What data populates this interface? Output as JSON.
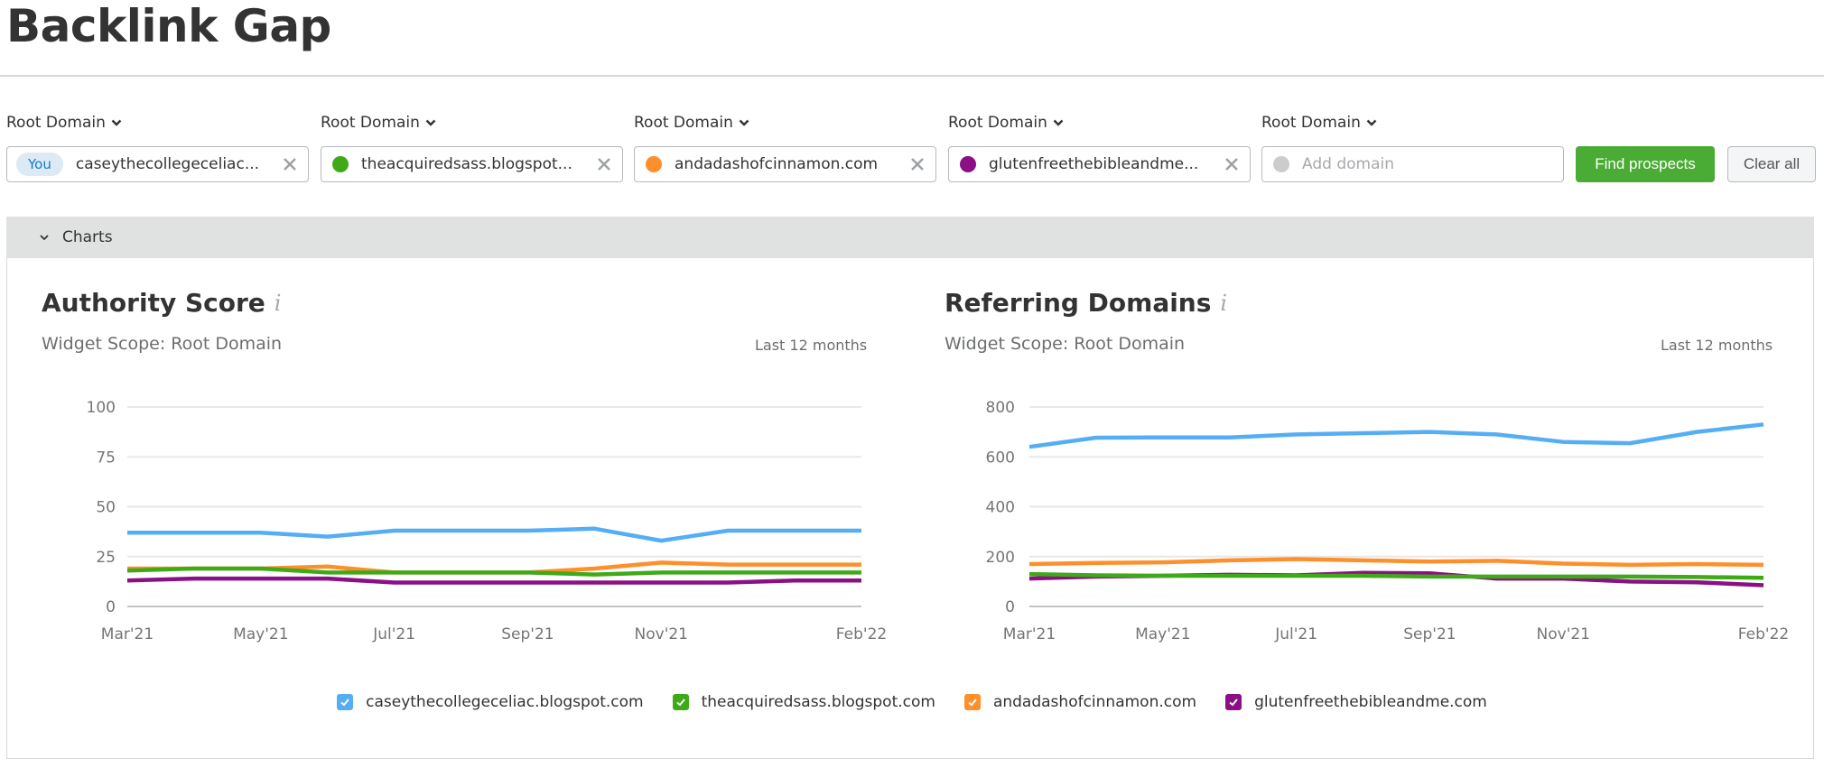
{
  "page": {
    "title": "Backlink Gap"
  },
  "domains": [
    {
      "scope": "Root Domain",
      "value": "caseythecollegeceliac...",
      "badge": "You",
      "color": "#55aef5",
      "placeholder": ""
    },
    {
      "scope": "Root Domain",
      "value": "theacquiredsass.blogspot...",
      "badge": "",
      "color": "#3eaa18",
      "placeholder": ""
    },
    {
      "scope": "Root Domain",
      "value": "andadashofcinnamon.com",
      "badge": "",
      "color": "#ff8f2b",
      "placeholder": ""
    },
    {
      "scope": "Root Domain",
      "value": "glutenfreethebibleandme...",
      "badge": "",
      "color": "#8b0f85",
      "placeholder": ""
    },
    {
      "scope": "Root Domain",
      "value": "",
      "badge": "",
      "color": "#cccccc",
      "placeholder": "Add domain"
    }
  ],
  "buttons": {
    "find": "Find prospects",
    "clear": "Clear all"
  },
  "charts_section": {
    "label": "Charts"
  },
  "widgets": [
    {
      "title": "Authority Score",
      "info": "i",
      "scope": "Widget Scope: Root Domain",
      "period": "Last 12 months"
    },
    {
      "title": "Referring Domains",
      "info": "i",
      "scope": "Widget Scope: Root Domain",
      "period": "Last 12 months"
    }
  ],
  "legend": [
    {
      "label": "caseythecollegeceliac.blogspot.com",
      "color": "#55aef5",
      "checked": true
    },
    {
      "label": "theacquiredsass.blogspot.com",
      "color": "#3eaa18",
      "checked": true
    },
    {
      "label": "andadashofcinnamon.com",
      "color": "#ff8f2b",
      "checked": true
    },
    {
      "label": "glutenfreethebibleandme.com",
      "color": "#8b0f85",
      "checked": true
    }
  ],
  "chart_data": [
    {
      "type": "line",
      "title": "Authority Score",
      "xlabel": "",
      "ylabel": "",
      "x": [
        "Mar'21",
        "Apr'21",
        "May'21",
        "Jun'21",
        "Jul'21",
        "Aug'21",
        "Sep'21",
        "Oct'21",
        "Nov'21",
        "Dec'21",
        "Jan'22",
        "Feb'22"
      ],
      "xtick_labels": {
        "0": "Mar'21",
        "2": "May'21",
        "4": "Jul'21",
        "6": "Sep'21",
        "8": "Nov'21",
        "11": "Feb'22"
      },
      "yticks": [
        0,
        25,
        50,
        75,
        100
      ],
      "ylim": [
        0,
        100
      ],
      "grid": true,
      "legend": "bottom",
      "series": [
        {
          "name": "caseythecollegeceliac.blogspot.com",
          "color": "#55aef5",
          "values": [
            37,
            37,
            37,
            35,
            38,
            38,
            38,
            39,
            33,
            38,
            38,
            38
          ]
        },
        {
          "name": "theacquiredsass.blogspot.com",
          "color": "#3eaa18",
          "values": [
            18,
            19,
            19,
            17,
            17,
            17,
            17,
            16,
            17,
            17,
            17,
            17
          ]
        },
        {
          "name": "andadashofcinnamon.com",
          "color": "#ff8f2b",
          "values": [
            19,
            19,
            19,
            20,
            17,
            17,
            17,
            19,
            22,
            21,
            21,
            21
          ]
        },
        {
          "name": "glutenfreethebibleandme.com",
          "color": "#8b0f85",
          "values": [
            13,
            14,
            14,
            14,
            12,
            12,
            12,
            12,
            12,
            12,
            13,
            13
          ]
        }
      ]
    },
    {
      "type": "line",
      "title": "Referring Domains",
      "xlabel": "",
      "ylabel": "",
      "x": [
        "Mar'21",
        "Apr'21",
        "May'21",
        "Jun'21",
        "Jul'21",
        "Aug'21",
        "Sep'21",
        "Oct'21",
        "Nov'21",
        "Dec'21",
        "Jan'22",
        "Feb'22"
      ],
      "xtick_labels": {
        "0": "Mar'21",
        "2": "May'21",
        "4": "Jul'21",
        "6": "Sep'21",
        "8": "Nov'21",
        "11": "Feb'22"
      },
      "yticks": [
        0,
        200,
        400,
        600,
        800
      ],
      "ylim": [
        0,
        800
      ],
      "grid": true,
      "legend": "bottom",
      "series": [
        {
          "name": "caseythecollegeceliac.blogspot.com",
          "color": "#55aef5",
          "values": [
            640,
            677,
            678,
            678,
            690,
            695,
            700,
            690,
            660,
            655,
            700,
            730
          ]
        },
        {
          "name": "theacquiredsass.blogspot.com",
          "color": "#3eaa18",
          "values": [
            130,
            125,
            123,
            123,
            123,
            123,
            120,
            120,
            120,
            120,
            118,
            115
          ]
        },
        {
          "name": "andadashofcinnamon.com",
          "color": "#ff8f2b",
          "values": [
            170,
            175,
            177,
            185,
            190,
            185,
            180,
            183,
            172,
            167,
            170,
            167
          ]
        },
        {
          "name": "glutenfreethebibleandme.com",
          "color": "#8b0f85",
          "values": [
            112,
            120,
            123,
            127,
            125,
            135,
            133,
            112,
            112,
            100,
            97,
            85
          ]
        }
      ]
    }
  ]
}
